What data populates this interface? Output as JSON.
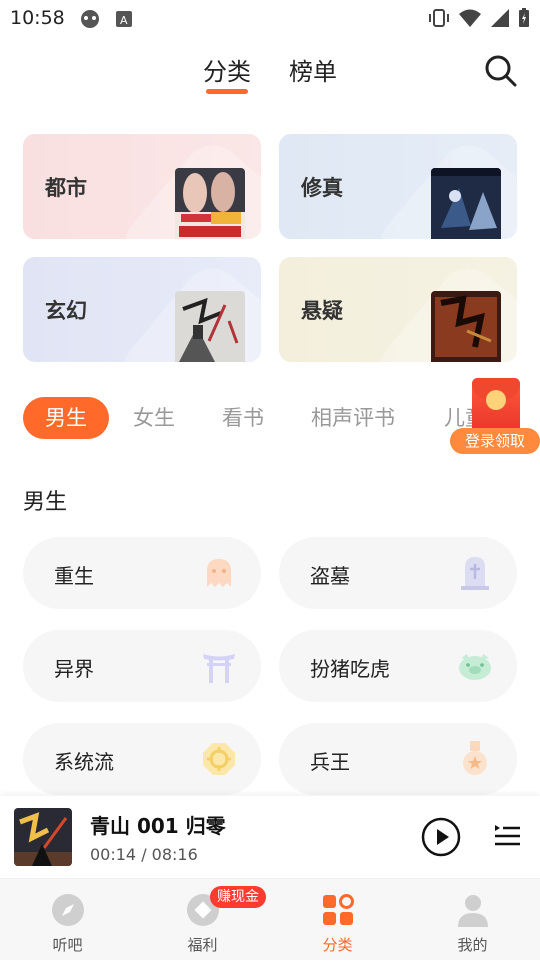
{
  "status_bar": {
    "time": "10:58"
  },
  "header": {
    "tabs": [
      {
        "label": "分类",
        "active": true
      },
      {
        "label": "榜单",
        "active": false
      }
    ]
  },
  "categories": [
    {
      "label": "都市"
    },
    {
      "label": "修真"
    },
    {
      "label": "玄幻"
    },
    {
      "label": "悬疑"
    }
  ],
  "genre_tabs": [
    {
      "label": "男生",
      "active": true
    },
    {
      "label": "女生"
    },
    {
      "label": "看书"
    },
    {
      "label": "相声评书"
    },
    {
      "label": "儿童"
    }
  ],
  "promo": {
    "label": "登录领取"
  },
  "section": {
    "title": "男生"
  },
  "subgenres": [
    {
      "label": "重生",
      "icon": "ghost-icon"
    },
    {
      "label": "盗墓",
      "icon": "tombstone-icon"
    },
    {
      "label": "异界",
      "icon": "torii-gate-icon"
    },
    {
      "label": "扮猪吃虎",
      "icon": "pig-icon"
    },
    {
      "label": "系统流",
      "icon": "octagon-target-icon"
    },
    {
      "label": "兵王",
      "icon": "medal-icon"
    }
  ],
  "player": {
    "title": "青山 001 归零",
    "elapsed": "00:14",
    "duration": "08:16",
    "time_text": "00:14 / 08:16"
  },
  "bottom_nav": [
    {
      "label": "听吧",
      "icon": "compass-icon"
    },
    {
      "label": "福利",
      "icon": "coin-icon",
      "badge": "赚现金"
    },
    {
      "label": "分类",
      "icon": "grid-icon",
      "active": true
    },
    {
      "label": "我的",
      "icon": "user-icon"
    }
  ],
  "colors": {
    "accent": "#ff6a2a",
    "badge": "#ff3b30"
  }
}
